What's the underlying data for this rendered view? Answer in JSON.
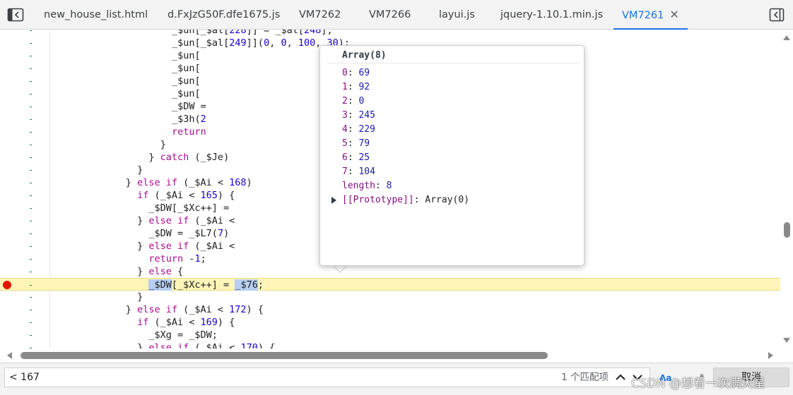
{
  "tabs": [
    {
      "label": "new_house_list.html",
      "active": false
    },
    {
      "label": "d.FxJzG50F.dfe1675.js",
      "active": false
    },
    {
      "label": "VM7262",
      "active": false
    },
    {
      "label": "VM7266",
      "active": false
    },
    {
      "label": "layui.js",
      "active": false
    },
    {
      "label": "jquery-1.10.1.min.js",
      "active": false
    },
    {
      "label": "VM7261",
      "active": true
    }
  ],
  "icons": {
    "navigator_toggle": "panel-left-icon",
    "debugger_toggle": "panel-right-icon",
    "tab_close": "close-icon",
    "breakpoint": "breakpoint-icon",
    "prototype_expand": "triangle-right-icon",
    "search_prev": "chevron-up-icon",
    "search_next": "chevron-down-icon"
  },
  "tab_close_glyph": "✕",
  "gutter_marker": "-",
  "code_lines": [
    {
      "indent": 20,
      "text": "_$un[_$al[228]] = _$al[248];"
    },
    {
      "indent": 20,
      "text": "_$un[_$al[249]](0, 0, 100, 30);"
    },
    {
      "indent": 20,
      "text": "_$un["
    },
    {
      "indent": 20,
      "text": "_$un["
    },
    {
      "indent": 20,
      "text": "_$un["
    },
    {
      "indent": 20,
      "text": "_$un["
    },
    {
      "indent": 20,
      "text": "_$DW ="
    },
    {
      "indent": 20,
      "text": "_$3h(2"
    },
    {
      "indent": 20,
      "text": "return"
    },
    {
      "indent": 18,
      "text": "}"
    },
    {
      "indent": 16,
      "text": "} catch (_$Je)"
    },
    {
      "indent": 14,
      "text": "}"
    },
    {
      "indent": 12,
      "text": "} else if (_$Ai < 168)"
    },
    {
      "indent": 14,
      "text": "if (_$Ai < 165) {"
    },
    {
      "indent": 16,
      "text": "_$DW[_$Xc++] ="
    },
    {
      "indent": 14,
      "text": "} else if (_$Ai <"
    },
    {
      "indent": 16,
      "text": "_$DW = _$L7(7)"
    },
    {
      "indent": 14,
      "text": "} else if (_$Ai <"
    },
    {
      "indent": 16,
      "text": "return -1;"
    },
    {
      "indent": 14,
      "text": "} else {"
    },
    {
      "indent": 16,
      "text": "_$DW[_$Xc++] = _$76;",
      "highlight": true
    },
    {
      "indent": 14,
      "text": "}"
    },
    {
      "indent": 12,
      "text": "} else if (_$Ai < 172) {"
    },
    {
      "indent": 14,
      "text": "if (_$Ai < 169) {"
    },
    {
      "indent": 16,
      "text": "_$Xg = _$DW;"
    },
    {
      "indent": 14,
      "text": "} else if (_$Ai < 170) {"
    }
  ],
  "popover": {
    "title": "Array(8)",
    "entries": [
      {
        "key": "0",
        "value": "69"
      },
      {
        "key": "1",
        "value": "92"
      },
      {
        "key": "2",
        "value": "0"
      },
      {
        "key": "3",
        "value": "245"
      },
      {
        "key": "4",
        "value": "229"
      },
      {
        "key": "5",
        "value": "79"
      },
      {
        "key": "6",
        "value": "25"
      },
      {
        "key": "7",
        "value": "104"
      }
    ],
    "length_key": "length",
    "length_value": "8",
    "proto_key": "[[Prototype]]",
    "proto_value": "Array(0)"
  },
  "search": {
    "value": "< 167",
    "match_count": "1 个匹配项",
    "aa_label": "Aa",
    "dot_label": ".*",
    "cancel_label": "取消"
  },
  "watermark": "CSDN @想看一次满天星",
  "colors": {
    "accent": "#1a73e8",
    "breakpoint": "#e51400",
    "highlight_line": "#fff5b8",
    "keyword": "#aa0d91",
    "number": "#1c00cf"
  }
}
